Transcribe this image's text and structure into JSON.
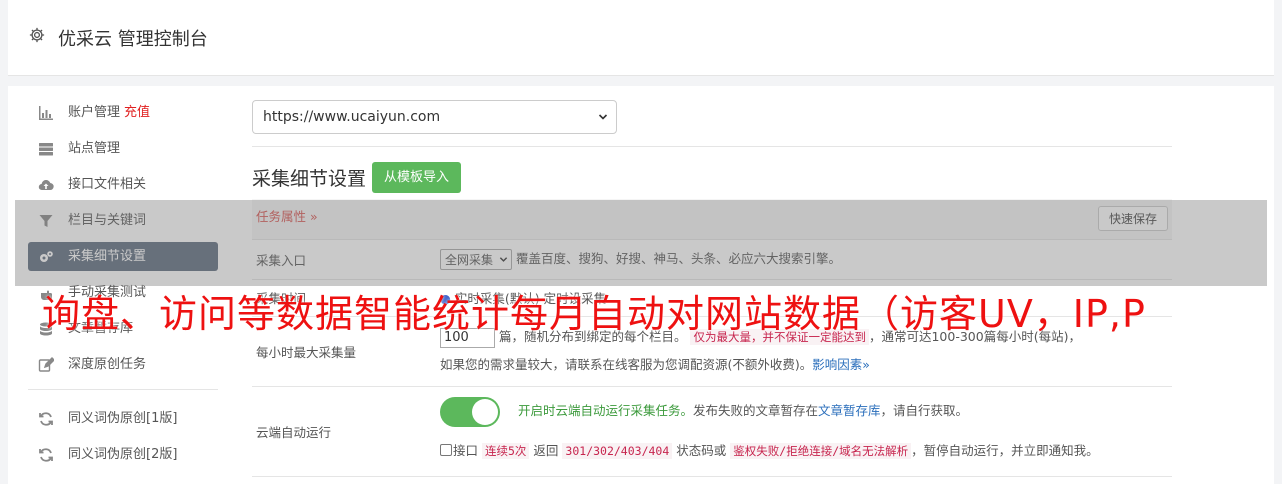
{
  "header": {
    "title": "优采云 管理控制台",
    "icon": "gear-icon"
  },
  "sidebar": {
    "items": [
      {
        "label": "账户管理",
        "tag": "充值",
        "icon": "bar-chart-icon"
      },
      {
        "label": "站点管理",
        "icon": "server-icon"
      },
      {
        "label": "接口文件相关",
        "icon": "cloud-upload-icon"
      },
      {
        "label": "栏目与关键词",
        "icon": "filter-icon"
      },
      {
        "label": "采集细节设置",
        "icon": "cogs-icon",
        "active": true
      },
      {
        "label": "手动采集测试",
        "icon": "hand-icon"
      },
      {
        "label": "文章暂存库",
        "icon": "database-icon"
      },
      {
        "label": "深度原创任务",
        "icon": "edit-icon"
      }
    ],
    "items2": [
      {
        "label": "同义词伪原创[1版]",
        "icon": "refresh-icon"
      },
      {
        "label": "同义词伪原创[2版]",
        "icon": "refresh-icon"
      }
    ]
  },
  "content": {
    "url_select": "https://www.ucaiyun.com",
    "section_title": "采集细节设置",
    "import_button": "从模板导入",
    "task_attr": "任务属性",
    "quick_save": "快速保存",
    "rows": {
      "entry_label": "采集入口",
      "entry_select": "全网采集",
      "entry_desc": "覆盖百度、搜狗、好搜、神马、头条、必应六大搜索引擎。",
      "mode_label": "采集时间",
      "mode_desc": "实时采集(默认)   定时设采集",
      "max_label": "每小时最大采集量",
      "max_value": "100",
      "max_desc1": "篇，随机分布到绑定的每个栏目。",
      "max_code": "仅为最大量，并不保证一定能达到",
      "max_desc2": "，通常可达100-300篇每小时(每站)，",
      "max_desc3": "如果您的需求量较大，请联系在线客服为您调配资源(不额外收费)。",
      "max_link": "影响因素",
      "cloud_label": "云端自动运行",
      "cloud_desc1": "开启时云端自动运行采集任务。",
      "cloud_desc2": "发布失败的文章暂存在",
      "cloud_link": "文章暂存库",
      "cloud_desc3": "，请自行获取。",
      "cloud_cb_label": "接口",
      "cloud_code1": "连续5次",
      "cloud_txt1": "返回",
      "cloud_code2": "301/302/403/404",
      "cloud_txt2": "状态码或",
      "cloud_code3": "鉴权失败/拒绝连接/域名无法解析",
      "cloud_txt3": "，暂停自动运行，并立即通知我。"
    }
  },
  "overlay": {
    "text": "询盘、访问等数据智能统计每月自动对网站数据（访客UV，IP,P"
  },
  "colors": {
    "accent_green": "#5cb85c",
    "active_nav": "#5d6b7e",
    "danger": "#e02020"
  }
}
